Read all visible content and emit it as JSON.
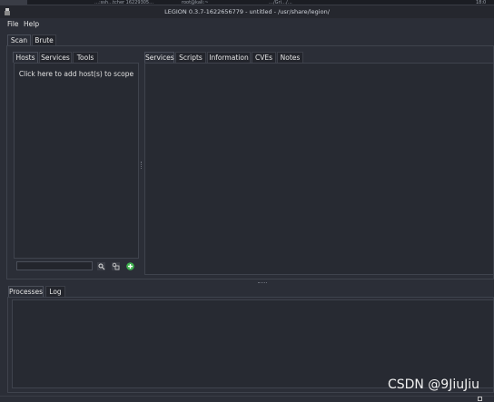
{
  "os_strip": {
    "tabs": [
      "…:ssh…tcher  16229305…",
      "root@kali:~",
      "…/Gri…/…"
    ],
    "right_text": "18:0"
  },
  "window": {
    "title": "LEGION 0.3.7-1622656779 - untitled - /usr/share/legion/"
  },
  "menu": {
    "file": "File",
    "help": "Help"
  },
  "main_tabs": {
    "scan": "Scan",
    "brute": "Brute"
  },
  "left_tabs": {
    "hosts": "Hosts",
    "services": "Services",
    "tools": "Tools"
  },
  "scope_hint": "Click here to add host(s) to scope",
  "right_tabs": {
    "services": "Services",
    "scripts": "Scripts",
    "information": "Information",
    "cves": "CVEs",
    "notes": "Notes"
  },
  "bottom_tabs": {
    "processes": "Processes",
    "log": "Log"
  },
  "watermark": "CSDN @9JiuJiu",
  "icons": {
    "search": "search-icon",
    "filter": "filter-icon",
    "add": "add-host-icon",
    "app": "legion-app-icon"
  },
  "colors": {
    "background": "#2b2e37",
    "add_button": "#3fb34f"
  }
}
